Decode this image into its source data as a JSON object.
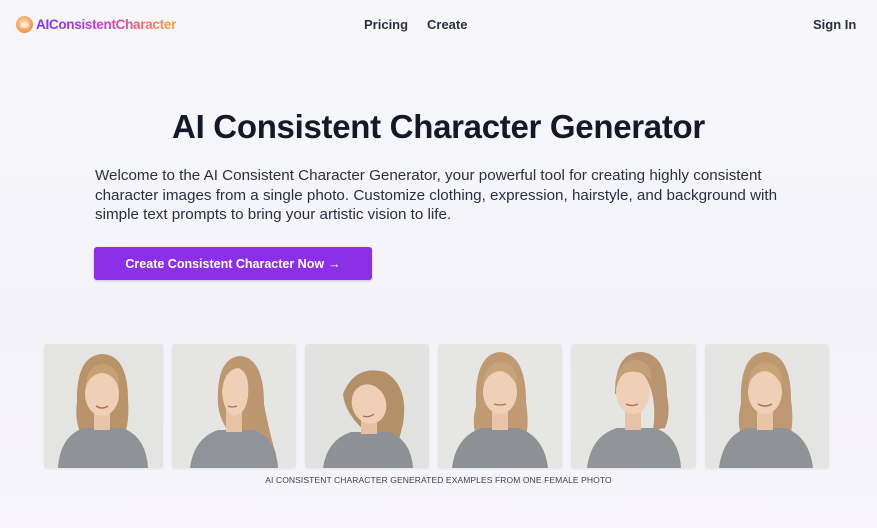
{
  "nav": {
    "logo_text": "AIConsistentCharacter",
    "logo_icon": "avatar-logo-icon",
    "links": [
      {
        "label": "Pricing"
      },
      {
        "label": "Create"
      }
    ],
    "sign_in_label": "Sign In"
  },
  "hero": {
    "title": "AI Consistent Character Generator",
    "description": "Welcome to the AI Consistent Character Generator, your powerful tool for creating highly consistent character images from a single photo. Customize clothing, expression, hairstyle, and background with simple text prompts to bring your artistic vision to life.",
    "cta_label": "Create Consistent Character Now",
    "cta_icon": "arrow-right-icon",
    "cta_arrow": "→",
    "accent_color": "#8b30e6"
  },
  "gallery": {
    "photos": [
      {
        "pose": "front-smile"
      },
      {
        "pose": "profile-right"
      },
      {
        "pose": "head-tilt"
      },
      {
        "pose": "front-neutral"
      },
      {
        "pose": "ponytail-three-quarter"
      },
      {
        "pose": "front-smile-2"
      }
    ],
    "caption": "AI CONSISTENT CHARACTER GENERATED EXAMPLES FROM ONE FEMALE PHOTO"
  }
}
